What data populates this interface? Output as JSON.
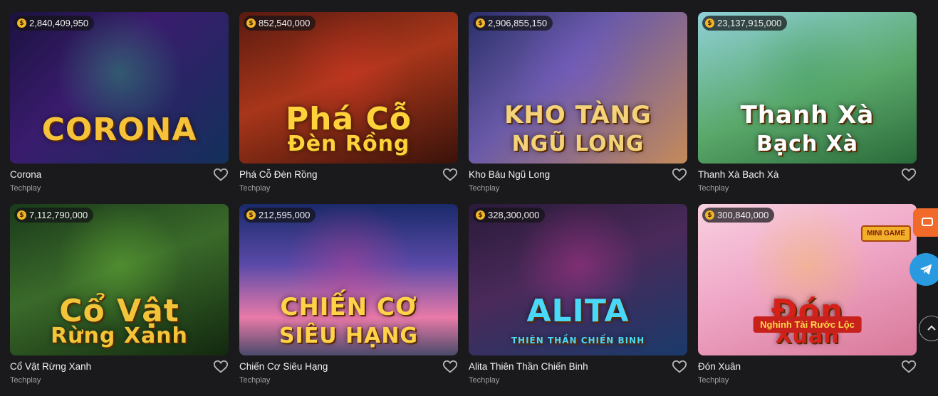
{
  "games": [
    {
      "name": "Corona",
      "provider": "Techplay",
      "jackpot": "2,840,409,950",
      "logo": "CORONA",
      "logo2": "",
      "bg": "linear-gradient(135deg,#1b1240 0%,#3a1c6e 40%,#13305a 100%)",
      "logo_color": "#f6c23a",
      "accent": "#2ad17a"
    },
    {
      "name": "Phá Cỗ Đèn Rồng",
      "provider": "Techplay",
      "jackpot": "852,540,000",
      "logo": "Phá Cỗ",
      "logo2": "Đèn Rồng",
      "bg": "linear-gradient(160deg,#5a1a10 0%,#a8361a 45%,#3a120a 100%)",
      "logo_color": "#ffd13a",
      "accent": "#e8352a"
    },
    {
      "name": "Kho Báu Ngũ Long",
      "provider": "Techplay",
      "jackpot": "2,906,855,150",
      "logo": "KHO TÀNG",
      "logo2": "NGŨ LONG",
      "bg": "linear-gradient(135deg,#2a2f6a 0%,#6a5aa8 40%,#c48a5a 100%)",
      "logo_color": "#f4d27a",
      "accent": "#7a5ad8"
    },
    {
      "name": "Thanh Xà Bạch Xà",
      "provider": "Techplay",
      "jackpot": "23,137,915,000",
      "logo": "Thanh Xà",
      "logo2": "Bạch Xà",
      "bg": "linear-gradient(160deg,#8fd0d8 0%,#5aa86a 55%,#2a6a3a 100%)",
      "logo_color": "#ffffff",
      "accent": "#3a9a5a"
    },
    {
      "name": "Cổ Vật Rừng Xanh",
      "provider": "Techplay",
      "jackpot": "7,112,790,000",
      "logo": "Cổ Vật",
      "logo2": "Rừng Xanh",
      "bg": "linear-gradient(160deg,#1a3a1a 0%,#3a6a2a 45%,#12280f 100%)",
      "logo_color": "#f2c43a",
      "accent": "#7ad23a"
    },
    {
      "name": "Chiến Cơ Siêu Hạng",
      "provider": "Techplay",
      "jackpot": "212,595,000",
      "logo": "CHIẾN CƠ",
      "logo2": "SIÊU HẠNG",
      "bg": "linear-gradient(180deg,#1a2a6a 0%,#5a4aa8 40%,#e87aa8 75%,#4a4a6a 100%)",
      "logo_color": "#ffd24a",
      "accent": "#e83a8a"
    },
    {
      "name": "Alita Thiên Thần Chiến Binh",
      "provider": "Techplay",
      "jackpot": "328,300,000",
      "logo": "ALITA",
      "logo2": "THIÊN THẦN CHIẾN BINH",
      "bg": "linear-gradient(160deg,#2a1a3a 0%,#4a2a5a 45%,#1a3a6a 100%)",
      "logo_color": "#4ad8f8",
      "accent": "#e83aa8"
    },
    {
      "name": "Đón Xuân",
      "provider": "Techplay",
      "jackpot": "300,840,000",
      "logo": "Đón",
      "logo2": "Xuân",
      "bg": "linear-gradient(160deg,#f8d0e0 0%,#f0a8c8 45%,#d87898 100%)",
      "logo_color": "#d8201a",
      "accent": "#f2c43a"
    }
  ],
  "mini_game_badge": "MINI GAME",
  "tagline_don_xuan": "Nghinh Tài Rước Lộc"
}
